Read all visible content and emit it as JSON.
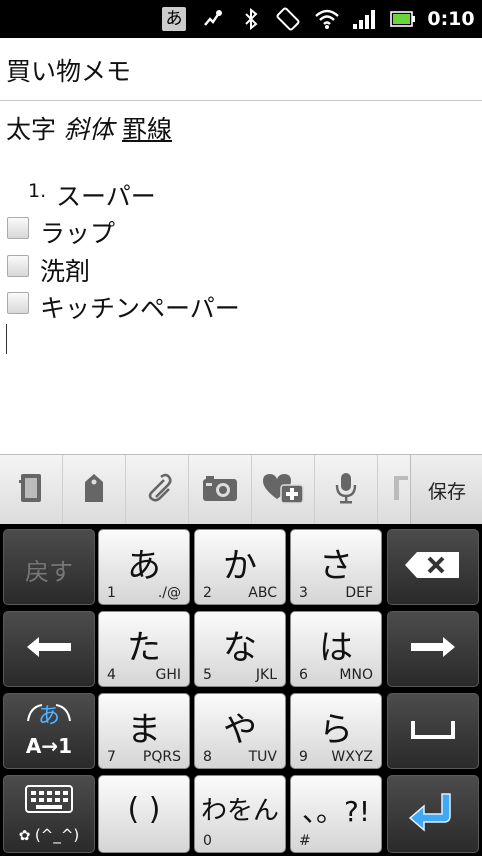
{
  "status_bar": {
    "ime_indicator": "あ",
    "clock": "0:10",
    "icons": [
      "ime-indicator-icon",
      "gesture-icon",
      "bluetooth-icon",
      "rotation-lock-icon",
      "wifi-icon",
      "signal-icon",
      "battery-icon"
    ]
  },
  "note": {
    "title": "買い物メモ",
    "format_buttons": {
      "bold": "太字",
      "italic": "斜体",
      "underline": "罫線"
    },
    "lines": [
      {
        "type": "numbered",
        "number": "1.",
        "text": "スーパー"
      },
      {
        "type": "checkbox",
        "checked": false,
        "text": "ラップ"
      },
      {
        "type": "checkbox",
        "checked": false,
        "text": "洗剤"
      },
      {
        "type": "checkbox",
        "checked": false,
        "text": "キッチンペーパー"
      }
    ]
  },
  "toolbar": {
    "icons": [
      "notebook-icon",
      "tag-icon",
      "paperclip-icon",
      "camera-icon",
      "add-favorite-icon",
      "microphone-icon",
      "format-icon"
    ],
    "save_label": "保存"
  },
  "keyboard": {
    "undo_label": "戻す",
    "keys": [
      {
        "main": "あ",
        "num": "1",
        "sub": "./@"
      },
      {
        "main": "か",
        "num": "2",
        "sub": "ABC"
      },
      {
        "main": "さ",
        "num": "3",
        "sub": "DEF"
      },
      {
        "main": "た",
        "num": "4",
        "sub": "GHI"
      },
      {
        "main": "な",
        "num": "5",
        "sub": "JKL"
      },
      {
        "main": "は",
        "num": "6",
        "sub": "MNO"
      },
      {
        "main": "ま",
        "num": "7",
        "sub": "PQRS"
      },
      {
        "main": "や",
        "num": "8",
        "sub": "TUV"
      },
      {
        "main": "ら",
        "num": "9",
        "sub": "WXYZ"
      }
    ],
    "paren_key": "( )",
    "wawon_key": "わをん",
    "wawon_num": "0",
    "punct_key": "、。?!",
    "punct_sub": "#",
    "mode_key": {
      "top": "あ",
      "bottom": "A→1"
    },
    "emoji_key_label": "(^_^)",
    "colors": {
      "light_key": "#e8e8e8",
      "dark_key": "#3a3a3a",
      "enter_accent": "#3fa9f5"
    }
  }
}
